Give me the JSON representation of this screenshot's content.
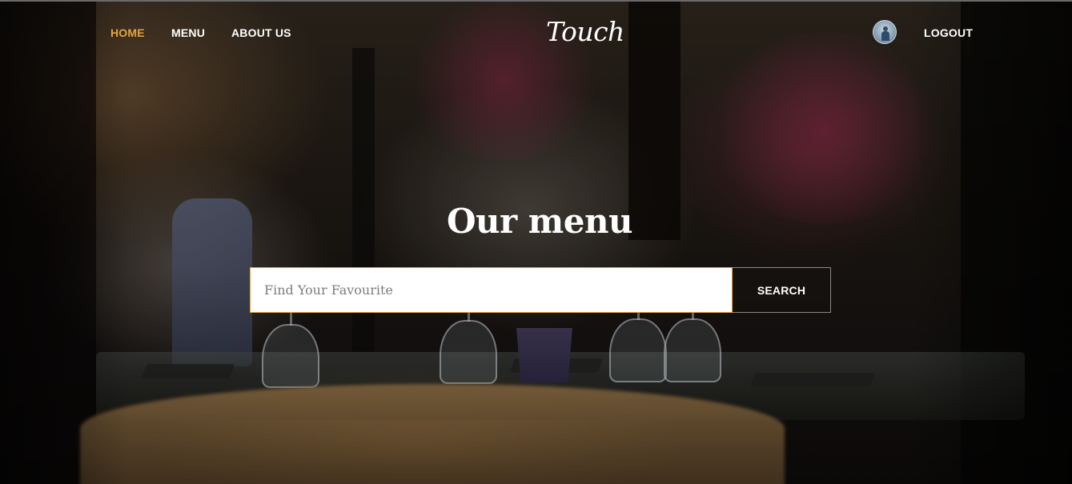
{
  "nav": {
    "links": [
      {
        "label": "HOME",
        "active": true
      },
      {
        "label": "MENU",
        "active": false
      },
      {
        "label": "ABOUT US",
        "active": false
      }
    ],
    "logo": "Touch",
    "logout_label": "LOGOUT"
  },
  "hero": {
    "title": "Our menu",
    "search": {
      "placeholder": "Find Your Favourite",
      "value": "",
      "button_label": "SEARCH"
    }
  },
  "colors": {
    "accent": "#e8a33b",
    "text": "#ffffff"
  },
  "icons": {
    "avatar": "user-avatar-icon"
  }
}
